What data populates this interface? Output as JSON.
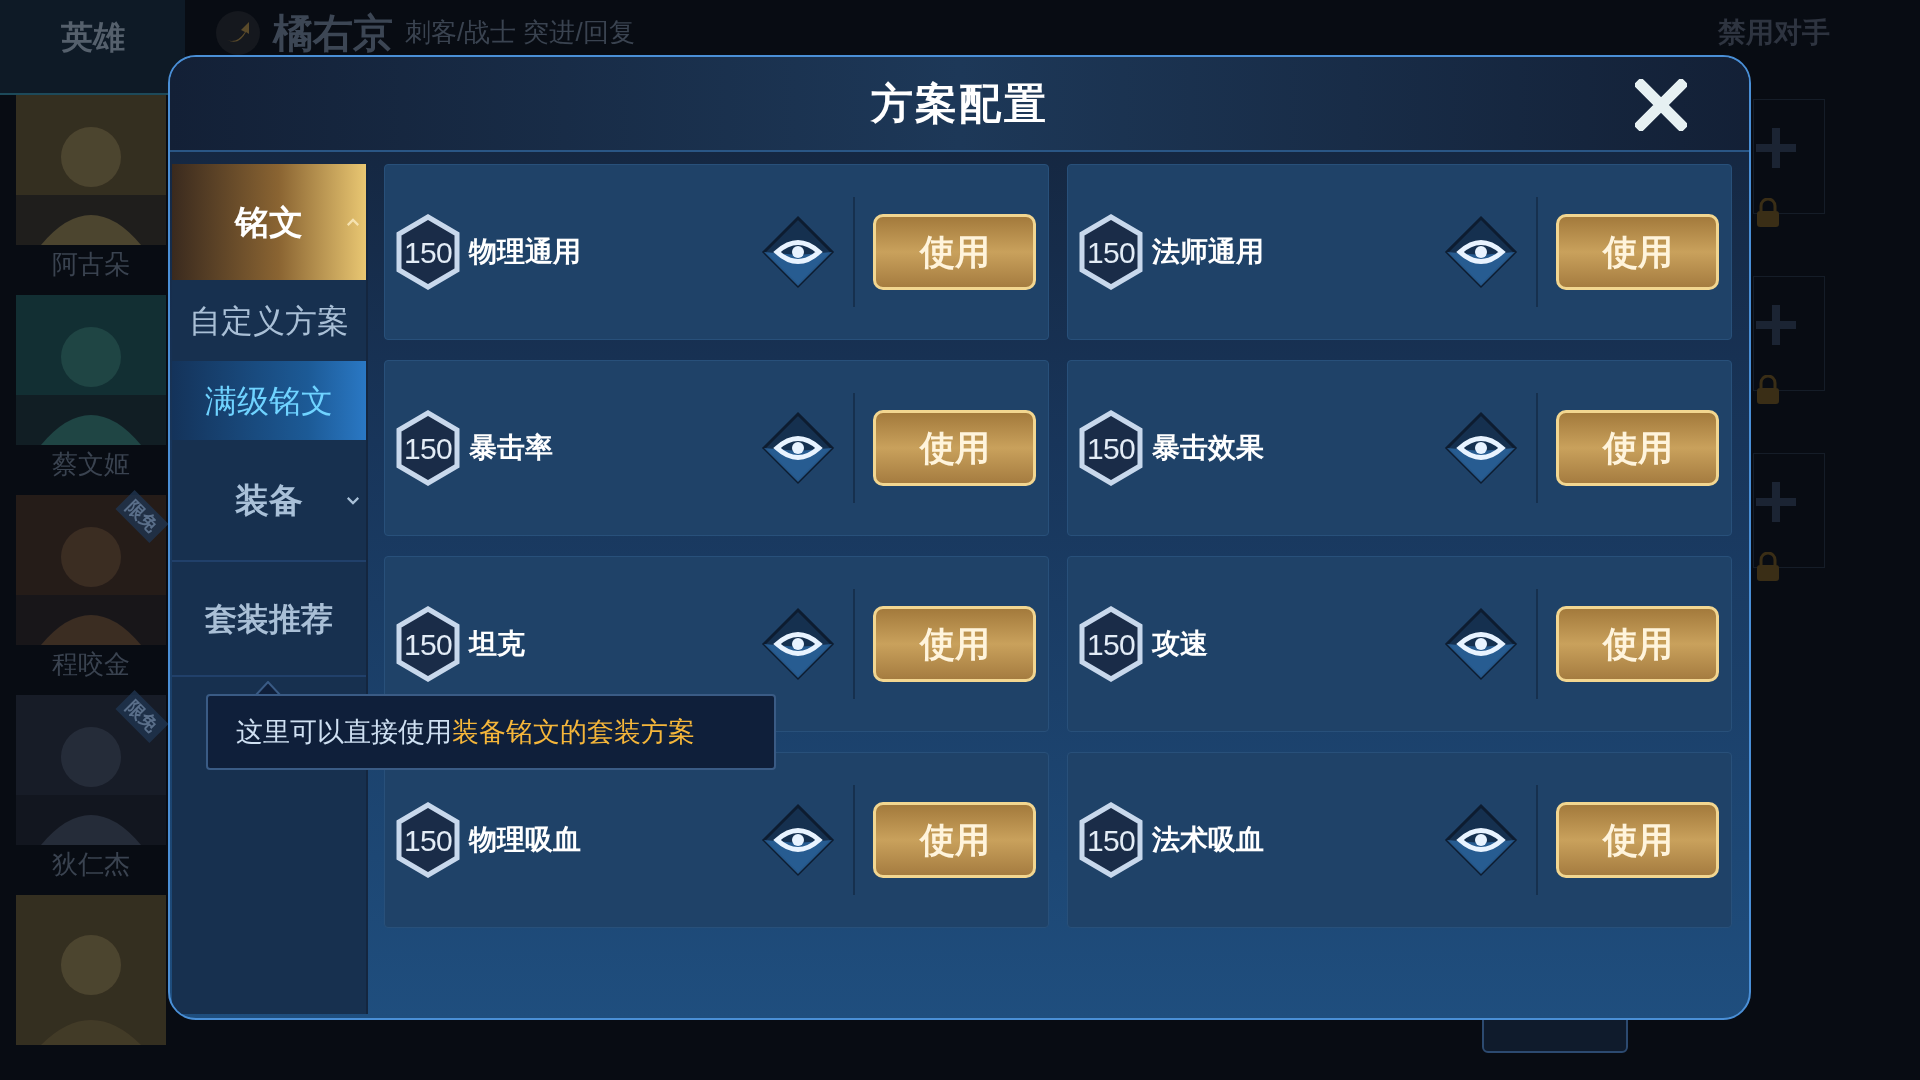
{
  "background": {
    "top_tabs": [
      {
        "label": "英雄",
        "selected": true
      }
    ],
    "hero": {
      "name": "橘右京",
      "roles": "刺客/战士 突进/回复"
    },
    "ban_label": "禁用对手",
    "hero_list": [
      {
        "name": "阿古朵"
      },
      {
        "name": "蔡文姬"
      },
      {
        "name": "程咬金",
        "tag": "限免"
      },
      {
        "name": "狄仁杰",
        "tag": "限免"
      }
    ]
  },
  "dialog": {
    "title": "方案配置",
    "sidebar": [
      {
        "kind": "group",
        "label": "铭文",
        "expanded": true
      },
      {
        "kind": "item",
        "label": "自定义方案",
        "selected": false
      },
      {
        "kind": "item",
        "label": "满级铭文",
        "selected": true
      },
      {
        "kind": "group",
        "label": "装备",
        "expanded": false
      },
      {
        "kind": "item",
        "label": "套装推荐",
        "selected": false
      }
    ],
    "tooltip": {
      "text": "这里可以直接使用",
      "highlight": "装备铭文的套装方案"
    },
    "presets": [
      {
        "level": "150",
        "name": "物理通用",
        "button": "使用"
      },
      {
        "level": "150",
        "name": "法师通用",
        "button": "使用"
      },
      {
        "level": "150",
        "name": "暴击率",
        "button": "使用"
      },
      {
        "level": "150",
        "name": "暴击效果",
        "button": "使用"
      },
      {
        "level": "150",
        "name": "坦克",
        "button": "使用"
      },
      {
        "level": "150",
        "name": "攻速",
        "button": "使用"
      },
      {
        "level": "150",
        "name": "物理吸血",
        "button": "使用"
      },
      {
        "level": "150",
        "name": "法术吸血",
        "button": "使用"
      }
    ]
  }
}
